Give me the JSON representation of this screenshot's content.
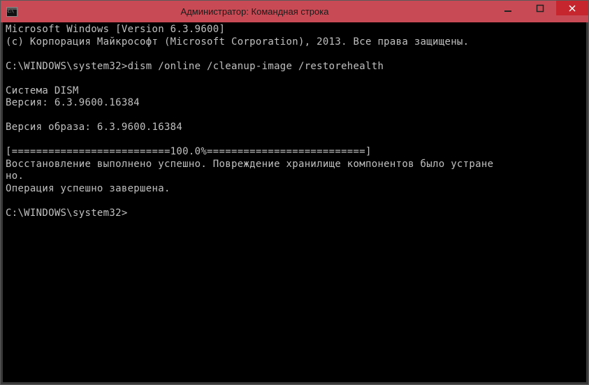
{
  "window": {
    "title": "Администратор: Командная строка"
  },
  "console": {
    "l1": "Microsoft Windows [Version 6.3.9600]",
    "l2": "(c) Корпорация Майкрософт (Microsoft Corporation), 2013. Все права защищены.",
    "l3": "",
    "l4": "C:\\WINDOWS\\system32>dism /online /cleanup-image /restorehealth",
    "l5": "",
    "l6": "Cиcтeмa DISM",
    "l7": "Версия: 6.3.9600.16384",
    "l8": "",
    "l9": "Версия образа: 6.3.9600.16384",
    "l10": "",
    "l11": "[==========================100.0%==========================]",
    "l12": "Восстановление выполнено успешно. Повреждение хранилище компонентов было устране",
    "l13": "но.",
    "l14": "Операция успешно завершена.",
    "l15": "",
    "l16": "C:\\WINDOWS\\system32>"
  }
}
